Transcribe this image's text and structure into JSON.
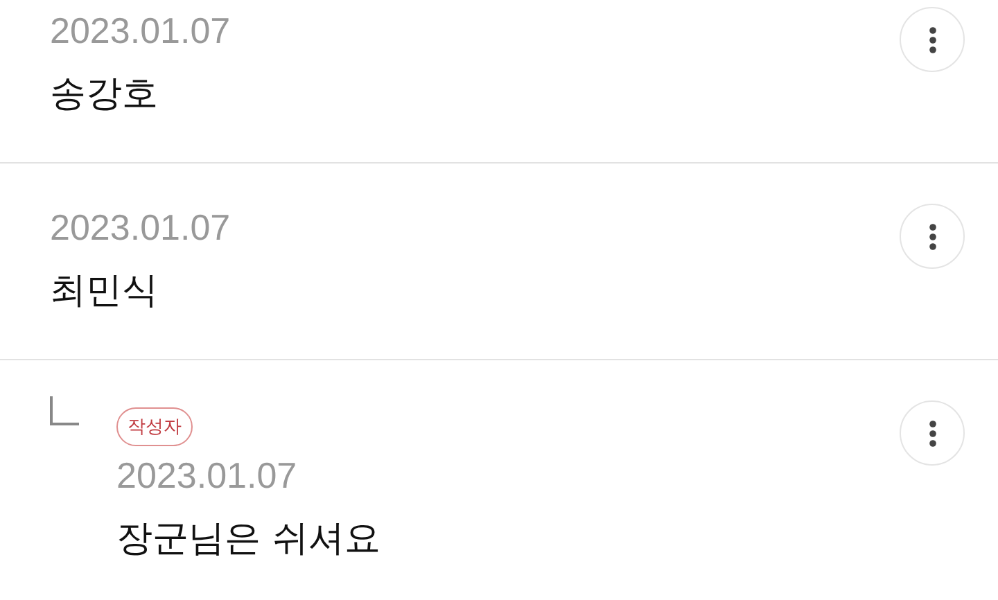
{
  "comments": [
    {
      "kind": "comment",
      "date": "2023.01.07",
      "text": "송강호"
    },
    {
      "kind": "comment",
      "date": "2023.01.07",
      "text": "최민식"
    },
    {
      "kind": "reply",
      "badge": "작성자",
      "date": "2023.01.07",
      "text": "장군님은 쉬셔요"
    }
  ]
}
